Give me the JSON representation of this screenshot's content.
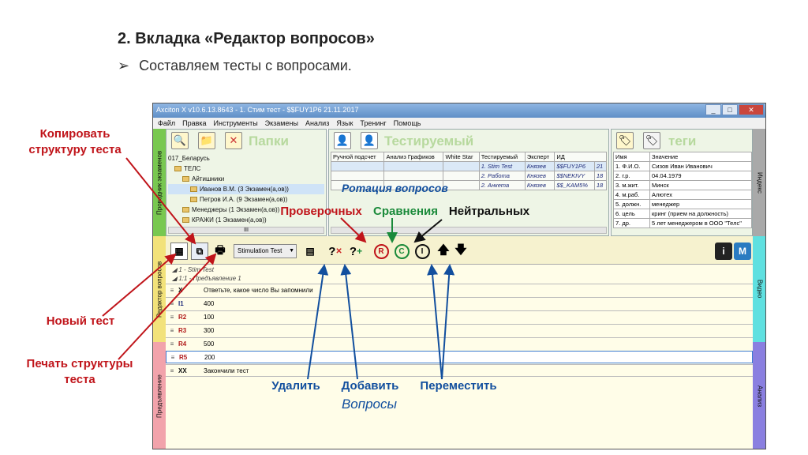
{
  "slide": {
    "title": "2. Вкладка «Редактор вопросов»",
    "bullet_mark": "➢",
    "bullet": "Составляем тесты с вопросами."
  },
  "app": {
    "title": "Axciton X v10.6.13.8643 - 1. Стим тест - $$FUY1P6 21.11.2017",
    "window_buttons": [
      "_",
      "□",
      "✕"
    ],
    "menu": [
      "Файл",
      "Правка",
      "Инструменты",
      "Экзамены",
      "Анализ",
      "Язык",
      "Тренинг",
      "Помощь"
    ],
    "side_tabs": {
      "left_top": "Проводник экзаменов",
      "left_mid": "Редактор вопросов",
      "left_bottom": "Предъявление",
      "right_top": "Индекс",
      "right_mid": "Видео",
      "right_bottom": "Анализ"
    },
    "folders": {
      "header": "Папки",
      "tree": [
        "017_Беларусь",
        "ТЕЛС",
        "Айтишники",
        "Иванов В.М. (3 Экзамен(а,ов))",
        "Петров И.А. (9 Экзамен(а,ов))",
        "Менеджеры (1 Экзамен(а,ов))",
        "КРАЖИ (1 Экзамен(а,ов))"
      ],
      "scroll_label": "III"
    },
    "tested": {
      "header": "Тестируемый",
      "columns": [
        "Ручной подсчет",
        "Анализ Графиков",
        "White Star",
        "Тестируемый",
        "Эксперт",
        "ИД"
      ],
      "rows": [
        {
          "name": "1. Stim Test",
          "expert": "Князев",
          "id": "$$FUY1P6",
          "n": "21"
        },
        {
          "name": "2. Работа",
          "expert": "Князев",
          "id": "$$NEKIVY",
          "n": "18"
        },
        {
          "name": "2. Анкета",
          "expert": "Князев",
          "id": "$$_KAM5%",
          "n": "18"
        }
      ],
      "overlay": "Ротация вопросов"
    },
    "tags": {
      "header": "теги",
      "columns": [
        "Имя",
        "Значение"
      ],
      "rows": [
        [
          "1. Ф.И.О.",
          "Сизов Иван Иванович"
        ],
        [
          "2. г.р.",
          "04.04.1979"
        ],
        [
          "3. м.жит.",
          "Минск"
        ],
        [
          "4. м.раб.",
          "Алютех"
        ],
        [
          "5. должн.",
          "менеджер"
        ],
        [
          "6. цель",
          "кринг (прием на должность)"
        ],
        [
          "7. др.",
          "5 лет менеджером в ООО \"Телс\""
        ]
      ]
    },
    "toolbar": {
      "dropdown": "Stimulation Test",
      "up": "🡅",
      "down": "🡇"
    },
    "editor": {
      "tree1": "1 - Stim Test",
      "tree2": "1:1 - Предъявление 1",
      "rows": [
        {
          "code": "X",
          "text": "Ответьте, какое число Вы запомнили",
          "color": "#111"
        },
        {
          "code": "I1",
          "text": "400",
          "color": "#1d2a7a"
        },
        {
          "code": "R2",
          "text": "100",
          "color": "#b01818"
        },
        {
          "code": "R3",
          "text": "300",
          "color": "#b01818"
        },
        {
          "code": "R4",
          "text": "500",
          "color": "#b01818"
        },
        {
          "code": "R5",
          "text": "200",
          "color": "#b01818"
        },
        {
          "code": "XX",
          "text": "Закончили тест",
          "color": "#111"
        }
      ]
    }
  },
  "annotations": {
    "copy": "Копировать структуру теста",
    "new_test": "Новый тест",
    "print": "Печать структуры теста",
    "control": "Проверочных",
    "compare": "Сравнения",
    "neutral": "Нейтральных",
    "delete": "Удалить",
    "add": "Добавить",
    "move": "Переместить",
    "questions": "Вопросы"
  }
}
